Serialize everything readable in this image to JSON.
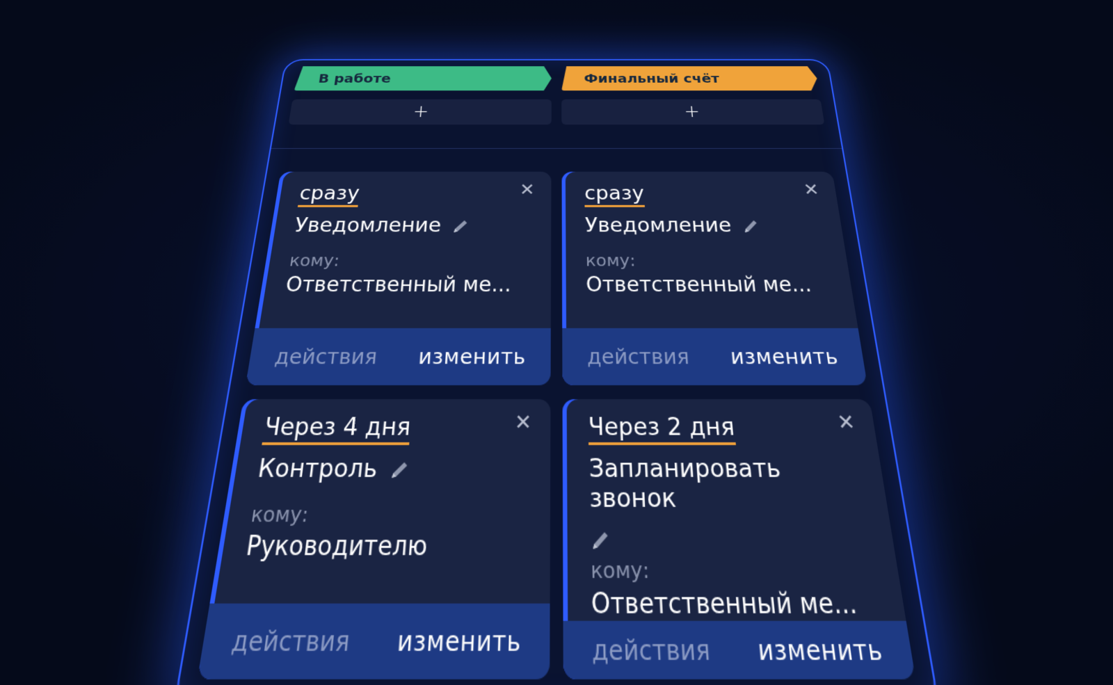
{
  "columns": [
    {
      "label": "В работе",
      "color": "#3dbb86",
      "add_label": "+"
    },
    {
      "label": "Финальный счёт",
      "color": "#f0a33a",
      "add_label": "+"
    }
  ],
  "cards": [
    {
      "when": "сразу",
      "title": "Уведомление",
      "to_label": "кому:",
      "to_value": "Ответственный ме...",
      "close": "✕",
      "actions_label": "действия",
      "edit_label": "изменить"
    },
    {
      "when": "сразу",
      "title": "Уведомление",
      "to_label": "кому:",
      "to_value": "Ответственный ме...",
      "close": "✕",
      "actions_label": "действия",
      "edit_label": "изменить"
    },
    {
      "when": "Через 4 дня",
      "title": "Контроль",
      "to_label": "кому:",
      "to_value": "Руководителю",
      "close": "✕",
      "actions_label": "действия",
      "edit_label": "изменить"
    },
    {
      "when": "Через 2 дня",
      "title": "Запланировать звонок",
      "to_label": "кому:",
      "to_value": "Ответственный ме...",
      "close": "✕",
      "actions_label": "действия",
      "edit_label": "изменить"
    }
  ],
  "icons": {
    "edit": "pencil-icon",
    "close": "close-icon"
  },
  "colors": {
    "accent": "#2f5cff",
    "underline": "#f0a03a",
    "card_bg": "#1a2443",
    "footer_bg": "#1e3a84"
  }
}
